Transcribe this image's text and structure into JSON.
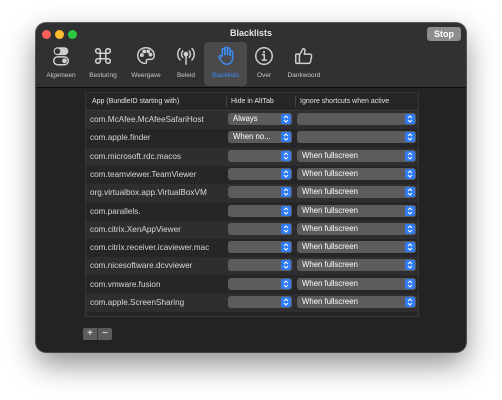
{
  "window": {
    "title": "Blacklists",
    "stop_label": "Stop"
  },
  "tabs": [
    {
      "label": "Algemeen",
      "icon": "toggles-icon"
    },
    {
      "label": "Besturing",
      "icon": "command-icon"
    },
    {
      "label": "Weergave",
      "icon": "palette-icon"
    },
    {
      "label": "Beleid",
      "icon": "antenna-icon"
    },
    {
      "label": "Blacklists",
      "icon": "hand-icon"
    },
    {
      "label": "Over",
      "icon": "info-icon"
    },
    {
      "label": "Dankwoord",
      "icon": "thumbs-up-icon"
    }
  ],
  "active_tab": "Blacklists",
  "table": {
    "columns": [
      "App (BundleID starting with)",
      "Hide in AltTab",
      "Ignore shortcuts when active"
    ],
    "rows": [
      {
        "app": "com.McAfee.McAfeeSafariHost",
        "hide": "Always",
        "ignore": ""
      },
      {
        "app": "com.apple.finder",
        "hide": "When no open window",
        "ignore": ""
      },
      {
        "app": "com.microsoft.rdc.macos",
        "hide": "",
        "ignore": "When fullscreen"
      },
      {
        "app": "com.teamviewer.TeamViewer",
        "hide": "",
        "ignore": "When fullscreen"
      },
      {
        "app": "org.virtualbox.app.VirtualBoxVM",
        "hide": "",
        "ignore": "When fullscreen"
      },
      {
        "app": "com.parallels.",
        "hide": "",
        "ignore": "When fullscreen"
      },
      {
        "app": "com.citrix.XenAppViewer",
        "hide": "",
        "ignore": "When fullscreen"
      },
      {
        "app": "com.citrix.receiver.icaviewer.mac",
        "hide": "",
        "ignore": "When fullscreen"
      },
      {
        "app": "com.nicesoftware.dcvviewer",
        "hide": "",
        "ignore": "When fullscreen"
      },
      {
        "app": "com.vmware.fusion",
        "hide": "",
        "ignore": "When fullscreen"
      },
      {
        "app": "com.apple.ScreenSharing",
        "hide": "",
        "ignore": "When fullscreen"
      }
    ]
  },
  "buttons": {
    "add_label": "+",
    "remove_label": "−"
  },
  "colors": {
    "accent": "#2f7cf6",
    "window_bg": "#232325"
  }
}
